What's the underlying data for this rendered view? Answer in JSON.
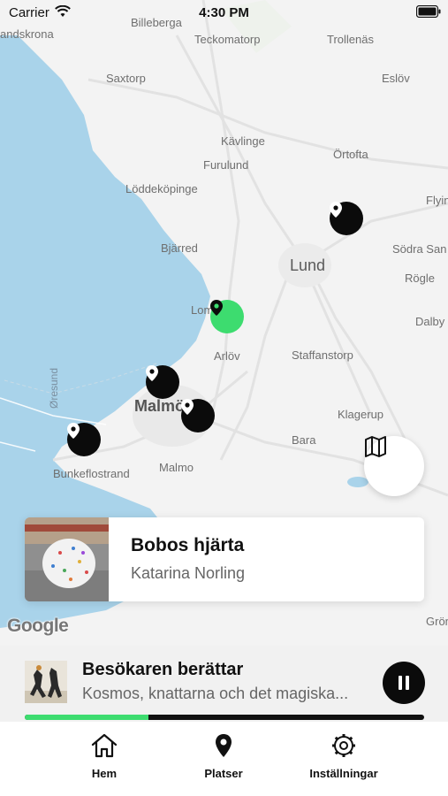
{
  "status_bar": {
    "carrier": "Carrier",
    "time": "4:30 PM"
  },
  "map": {
    "labels": {
      "landskrona": "andskrona",
      "billeberga": "Billeberga",
      "teckomatorp": "Teckomatorp",
      "trollenas": "Trollenäs",
      "saxtorp": "Saxtorp",
      "eslov": "Eslöv",
      "kavlinge": "Kävlinge",
      "ortofta": "Örtofta",
      "furulund": "Furulund",
      "loddekopinge": "Löddeköpinge",
      "flyinge": "Flyin",
      "bjarred": "Bjärred",
      "lund": "Lund",
      "sodra_sandby": "Södra San",
      "rogle": "Rögle",
      "lomma": "Lom",
      "dalby": "Dalby",
      "arlov": "Arlöv",
      "staffanstorp": "Staffanstorp",
      "oresund": "Øresund",
      "malmo": "Malmö",
      "klagerup": "Klagerup",
      "bara": "Bara",
      "bunkeflostrand": "Bunkeflostrand",
      "malmo_small": "Malmo",
      "gron": "Grön"
    },
    "google_logo": "Google"
  },
  "place_card": {
    "title": "Bobos hjärta",
    "artist": "Katarina Norling"
  },
  "player": {
    "title": "Besökaren berättar",
    "subtitle": "Kosmos, knattarna och det magiska...",
    "progress": 0.31
  },
  "tabs": [
    {
      "label": "Hem",
      "icon": "home-icon"
    },
    {
      "label": "Platser",
      "icon": "location-pin-icon"
    },
    {
      "label": "Inställningar",
      "icon": "gear-icon"
    }
  ],
  "colors": {
    "accent": "#3ddc6f",
    "pin": "#0b0b0b",
    "water": "#a9d3ea"
  }
}
